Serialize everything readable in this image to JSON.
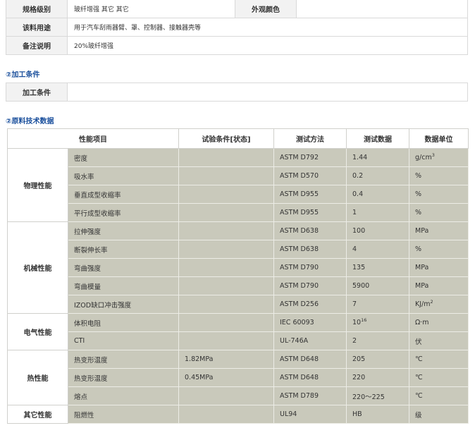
{
  "spec": {
    "grade_label": "规格级别",
    "grade_value": "玻纤增强 其它 其它",
    "appearance_color_label": "外观颜色",
    "appearance_color_value": "",
    "application_label": "该料用途",
    "application_value": "用于汽车刮雨器臂、罩、控制器、接触器壳等",
    "remarks_label": "备注说明",
    "remarks_value": "20%玻纤增强"
  },
  "processing": {
    "section_title": "②加工条件",
    "label": "加工条件",
    "value": ""
  },
  "tech_data": {
    "section_title": "②原料技术数据",
    "headers": [
      "性能项目",
      "试验条件[状态]",
      "测试方法",
      "测试数据",
      "数据单位"
    ],
    "groups": [
      {
        "name": "物理性能",
        "rows": [
          {
            "property": "密度",
            "condition": "",
            "method": "ASTM D792",
            "value": "1.44",
            "unit": "g/cm",
            "unit_sup": "3"
          },
          {
            "property": "吸水率",
            "condition": "",
            "method": "ASTM D570",
            "value": "0.2",
            "unit": "%"
          },
          {
            "property": "垂直成型收缩率",
            "condition": "",
            "method": "ASTM D955",
            "value": "0.4",
            "unit": "%"
          },
          {
            "property": "平行成型收缩率",
            "condition": "",
            "method": "ASTM D955",
            "value": "1",
            "unit": "%"
          }
        ]
      },
      {
        "name": "机械性能",
        "rows": [
          {
            "property": "拉伸强度",
            "condition": "",
            "method": "ASTM D638",
            "value": "100",
            "unit": "MPa"
          },
          {
            "property": "断裂伸长率",
            "condition": "",
            "method": "ASTM D638",
            "value": "4",
            "unit": "%"
          },
          {
            "property": "弯曲强度",
            "condition": "",
            "method": "ASTM D790",
            "value": "135",
            "unit": "MPa"
          },
          {
            "property": "弯曲模量",
            "condition": "",
            "method": "ASTM D790",
            "value": "5900",
            "unit": "MPa"
          },
          {
            "property": "IZOD缺口冲击强度",
            "condition": "",
            "method": "ASTM D256",
            "value": "7",
            "unit": "KJ/m",
            "unit_sup": "2"
          }
        ]
      },
      {
        "name": "电气性能",
        "rows": [
          {
            "property": "体积电阻",
            "condition": "",
            "method": "IEC 60093",
            "value": "10",
            "value_sup": "16",
            "unit": "Ω·m"
          },
          {
            "property": "CTI",
            "condition": "",
            "method": "UL-746A",
            "value": "2",
            "unit": "伏"
          }
        ]
      },
      {
        "name": "热性能",
        "rows": [
          {
            "property": "热变形温度",
            "condition": "1.82MPa",
            "method": "ASTM D648",
            "value": "205",
            "unit": "℃"
          },
          {
            "property": "热变形温度",
            "condition": "0.45MPa",
            "method": "ASTM D648",
            "value": "220",
            "unit": "℃"
          },
          {
            "property": "熔点",
            "condition": "",
            "method": "ASTM D789",
            "value": "220～225",
            "unit": "℃"
          }
        ]
      },
      {
        "name": "其它性能",
        "rows": [
          {
            "property": "阻燃性",
            "condition": "",
            "method": "UL94",
            "value": "HB",
            "unit": "级"
          }
        ]
      }
    ]
  }
}
